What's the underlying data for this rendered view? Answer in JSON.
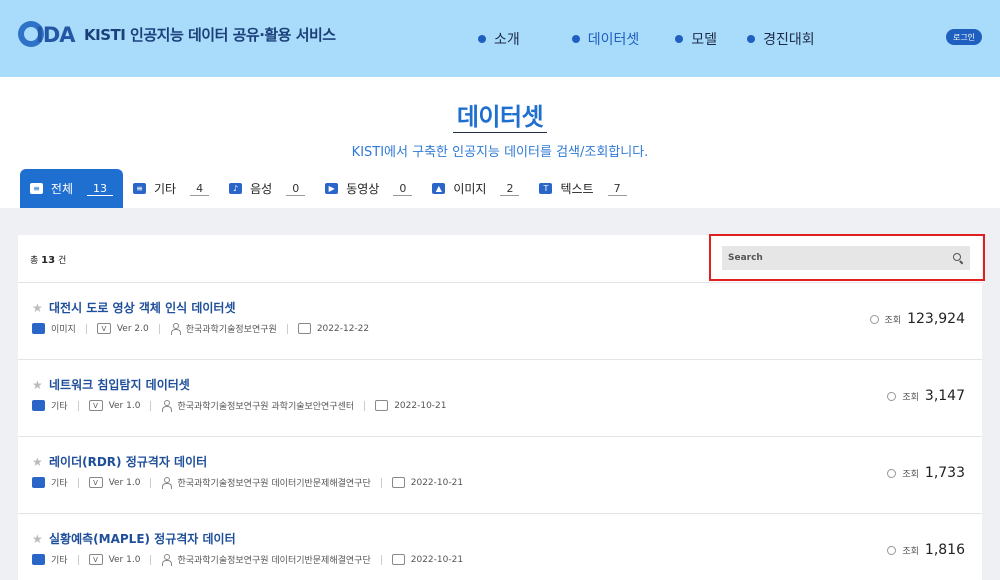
{
  "header": {
    "logo_text": "IDA",
    "site_title": "KISTI 인공지능 데이터 공유·활용 서비스",
    "nav": [
      {
        "label": "소개",
        "active": false
      },
      {
        "label": "데이터셋",
        "active": true
      },
      {
        "label": "모델",
        "active": false
      },
      {
        "label": "경진대회",
        "active": false
      }
    ],
    "login_label": "로그인"
  },
  "page": {
    "title": "데이터셋",
    "subtitle": "KISTI에서 구축한 인공지능 데이터를 검색/조회합니다."
  },
  "tabs": [
    {
      "label": "전체",
      "count": "13",
      "icon": "list-icon",
      "active": true
    },
    {
      "label": "기타",
      "count": "4",
      "icon": "list-icon"
    },
    {
      "label": "음성",
      "count": "0",
      "icon": "audio-icon"
    },
    {
      "label": "동영상",
      "count": "0",
      "icon": "video-icon"
    },
    {
      "label": "이미지",
      "count": "2",
      "icon": "image-icon"
    },
    {
      "label": "텍스트",
      "count": "7",
      "icon": "text-icon"
    }
  ],
  "list": {
    "total_prefix": "총",
    "total_count": "13",
    "total_suffix": "건",
    "search_placeholder": "Search",
    "view_label": "조회",
    "items": [
      {
        "title": "대전시 도로 영상 객체 인식 데이터셋",
        "type": "이미지",
        "version": "Ver 2.0",
        "org": "한국과학기술정보연구원",
        "date": "2022-12-22",
        "views": "123,924"
      },
      {
        "title": "네트워크 침입탐지 데이터셋",
        "type": "기타",
        "version": "Ver 1.0",
        "org": "한국과학기술정보연구원 과학기술보안연구센터",
        "date": "2022-10-21",
        "views": "3,147"
      },
      {
        "title": "레이더(RDR) 정규격자 데이터",
        "type": "기타",
        "version": "Ver 1.0",
        "org": "한국과학기술정보연구원 데이터기반문제해결연구단",
        "date": "2022-10-21",
        "views": "1,733"
      },
      {
        "title": "실황예측(MAPLE) 정규격자 데이터",
        "type": "기타",
        "version": "Ver 1.0",
        "org": "한국과학기술정보연구원 데이터기반문제해결연구단",
        "date": "2022-10-21",
        "views": "1,816"
      }
    ]
  },
  "colors": {
    "header_bg": "#a9dcfb",
    "accent": "#1f6fd0",
    "highlight_frame": "#e02020"
  }
}
